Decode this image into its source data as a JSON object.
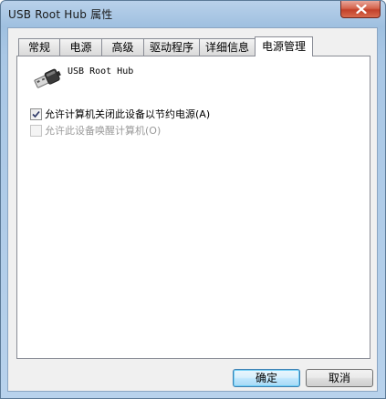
{
  "window": {
    "title": "USB Root Hub 属性"
  },
  "tabs": [
    {
      "label": "常规"
    },
    {
      "label": "电源"
    },
    {
      "label": "高级"
    },
    {
      "label": "驱动程序"
    },
    {
      "label": "详细信息"
    },
    {
      "label": "电源管理"
    }
  ],
  "active_tab": "电源管理",
  "device": {
    "name": "USB Root Hub",
    "icon": "usb-connector-icon"
  },
  "options": [
    {
      "label": "允许计算机关闭此设备以节约电源(A)",
      "checked": true,
      "enabled": true
    },
    {
      "label": "允许此设备唤醒计算机(O)",
      "checked": false,
      "enabled": false
    }
  ],
  "buttons": {
    "ok": "确定",
    "cancel": "取消"
  },
  "colors": {
    "title_bar": "#a9c7e5",
    "close_button": "#c2412a",
    "dialog_face": "#f0f0f0",
    "default_button": "#bee6fd"
  }
}
